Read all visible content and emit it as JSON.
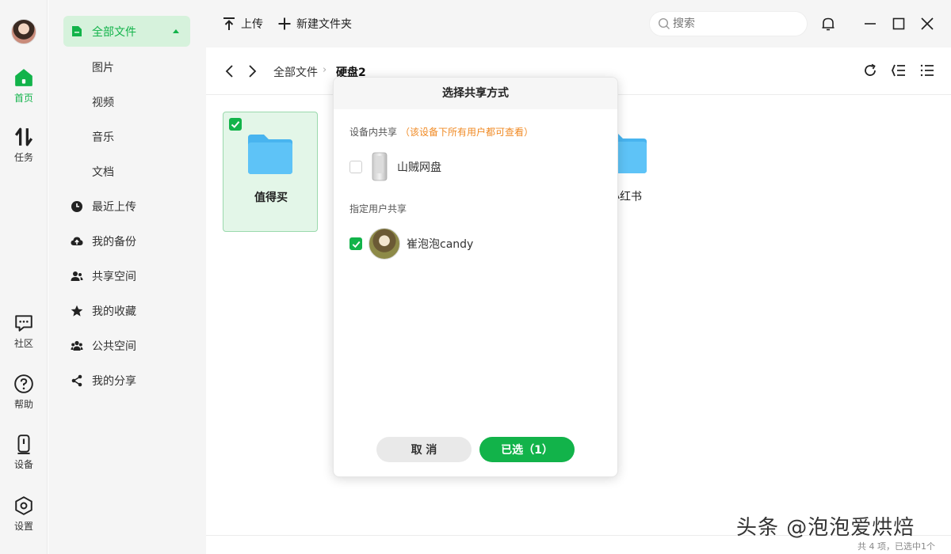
{
  "colors": {
    "accent": "#12b34a",
    "hint": "#f08a24",
    "folder": "#5ec3f7"
  },
  "rail": {
    "items": [
      {
        "label": "首页",
        "icon": "home-icon"
      },
      {
        "label": "任务",
        "icon": "transfer-icon"
      },
      {
        "label": "社区",
        "icon": "chat-icon"
      },
      {
        "label": "帮助",
        "icon": "help-icon"
      },
      {
        "label": "设备",
        "icon": "device-icon"
      },
      {
        "label": "设置",
        "icon": "settings-icon"
      }
    ]
  },
  "sidebar": {
    "header": "全部文件",
    "subitems": [
      "图片",
      "视频",
      "音乐",
      "文档"
    ],
    "items": [
      {
        "label": "最近上传",
        "icon": "clock-icon"
      },
      {
        "label": "我的备份",
        "icon": "cloud-upload-icon"
      },
      {
        "label": "共享空间",
        "icon": "users-icon"
      },
      {
        "label": "我的收藏",
        "icon": "star-icon"
      },
      {
        "label": "公共空间",
        "icon": "group-icon"
      },
      {
        "label": "我的分享",
        "icon": "share-icon"
      }
    ]
  },
  "toolbar": {
    "upload": "上传",
    "new_folder": "新建文件夹",
    "search_placeholder": "搜索"
  },
  "breadcrumb": {
    "root": "全部文件",
    "current": "硬盘2"
  },
  "files": [
    {
      "name": "值得买",
      "selected": true
    },
    {
      "name": "小红书",
      "selected": false
    }
  ],
  "dialog": {
    "title": "选择共享方式",
    "device_section": "设备内共享",
    "device_hint": "（该设备下所有用户都可查看）",
    "device_option": "山贼网盘",
    "device_checked": false,
    "user_section": "指定用户共享",
    "user_option": "崔泡泡candy",
    "user_checked": true,
    "cancel": "取 消",
    "confirm": "已选（1）"
  },
  "status": "共 4 项，已选中1个",
  "watermark": "头条 @泡泡爱烘焙"
}
